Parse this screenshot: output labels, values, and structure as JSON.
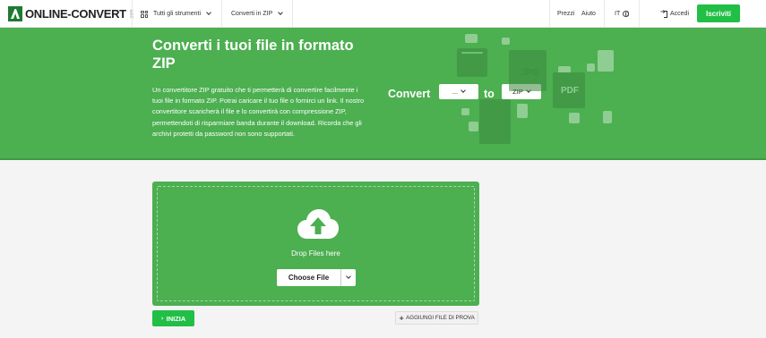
{
  "header": {
    "logo_text": "ONLINE-CONVERT",
    "logo_suffix": ".com",
    "tools_menu": "Tutti gli strumenti",
    "convert_menu": "Converti in ZIP",
    "prices": "Prezzi",
    "help": "Aiuto",
    "language": "IT",
    "login": "Accedi",
    "signup": "Iscriviti"
  },
  "hero": {
    "title": "Converti i tuoi file in formato ZIP",
    "description": "Un convertitore ZIP gratuito che ti permetterà di convertire facilmente i tuoi file in formato ZIP. Potrai caricare il tuo file o fornirci un link. Il nostro convertitore scaricherà il file e lo convertirà con compressione ZIP, permettendoti di risparmiare banda durante il download. Ricorda che gli archivi protetti da password non sono supportati.",
    "convert_label": "Convert",
    "from_value": "...",
    "to_label": "to",
    "to_value": "ZIP",
    "deco_jpg": "JPG",
    "deco_pdf": "PDF"
  },
  "upload": {
    "drop_label": "Drop Files here",
    "choose_file": "Choose File",
    "start_button": "INIZIA",
    "sample_button": "AGGIUNGI FILE DI PROVA"
  },
  "colors": {
    "brand_green": "#4caf50",
    "button_green": "#21bf46"
  }
}
